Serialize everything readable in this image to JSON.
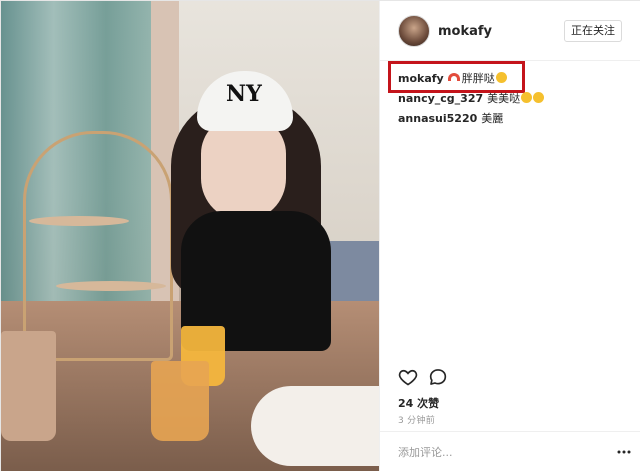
{
  "post": {
    "author": "mokafy",
    "follow_button": "正在关注",
    "comments": [
      {
        "user": "mokafy",
        "text": "胖胖哒",
        "emoji_before": "rainbow-emoji",
        "emoji_after": "smiling-emoji"
      },
      {
        "user": "nancy_cg_327",
        "text": "美美哒",
        "emoji_after": "grinning-emoji"
      },
      {
        "user": "annasui5220",
        "text": "美麗"
      }
    ],
    "likes": "24 次赞",
    "time_ago": "3 分钟前",
    "add_comment_placeholder": "添加评论..."
  },
  "photo": {
    "cap_logo": "NY"
  },
  "colors": {
    "highlight_box": "#c4141b",
    "text": "#262626",
    "secondary_text": "#999999"
  }
}
